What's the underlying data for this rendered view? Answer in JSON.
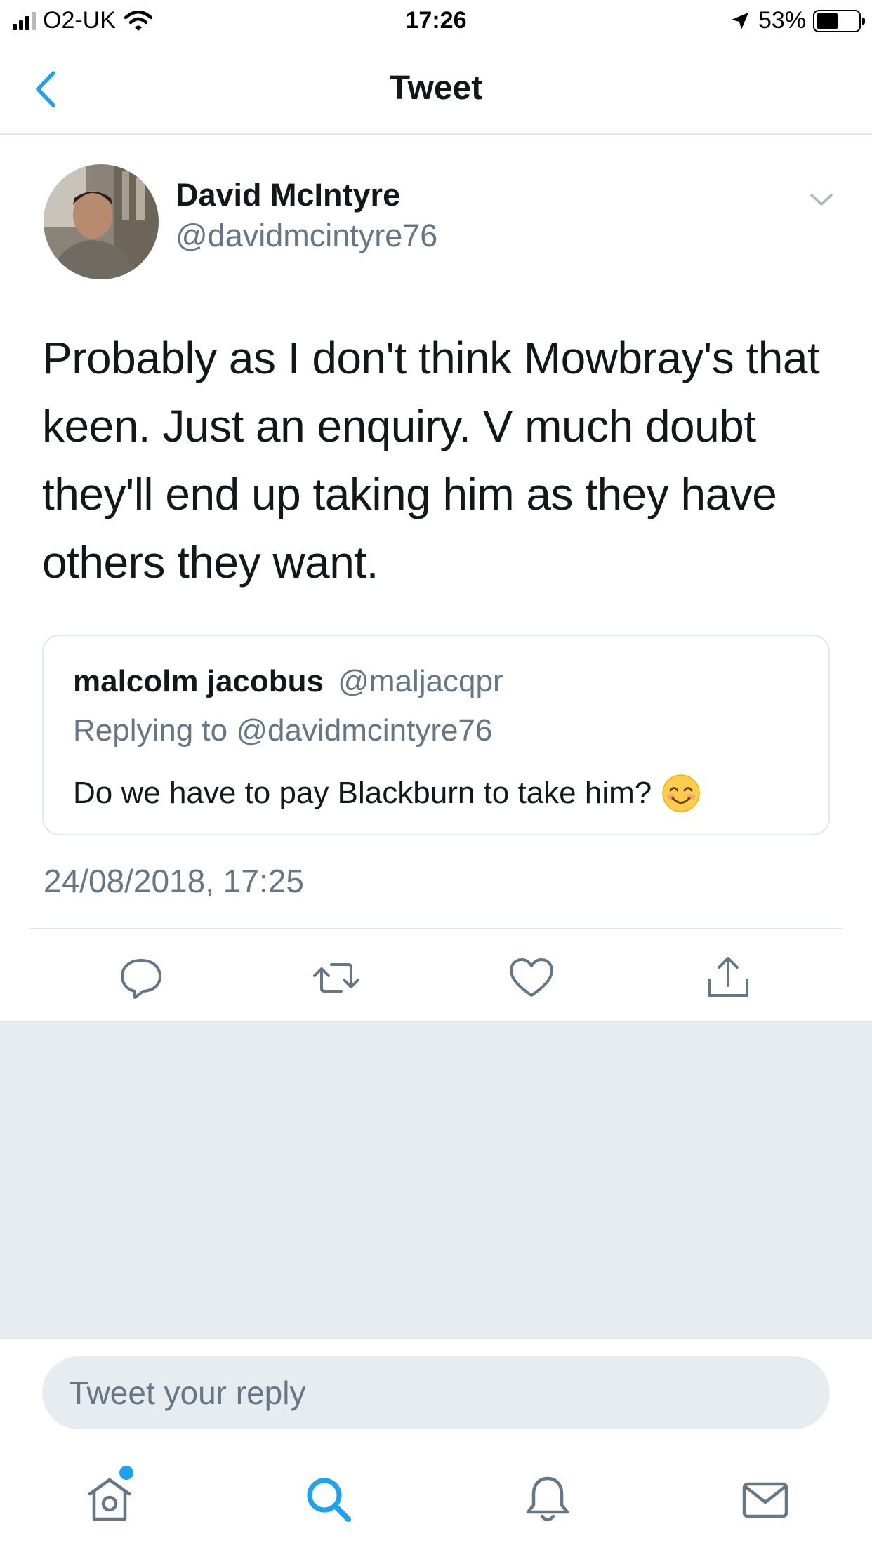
{
  "status_bar": {
    "carrier": "O2-UK",
    "time": "17:26",
    "battery": "53%"
  },
  "nav": {
    "title": "Tweet"
  },
  "tweet": {
    "author_name": "David McIntyre",
    "author_handle": "@davidmcintyre76",
    "text": "Probably as I don't think Mowbray's that keen. Just an enquiry. V much doubt they'll end up taking him as they have others they want.",
    "timestamp": "24/08/2018, 17:25"
  },
  "quoted_tweet": {
    "name": "malcolm jacobus",
    "handle": "@maljacqpr",
    "replying_to": "Replying to @davidmcintyre76",
    "text": "Do we have to pay Blackburn to take him?"
  },
  "actions": [
    "reply-icon",
    "retweet-icon",
    "like-icon",
    "share-icon"
  ],
  "reply": {
    "placeholder": "Tweet your reply"
  },
  "tab_bar": [
    "home-icon",
    "search-icon",
    "notifications-icon",
    "messages-icon"
  ],
  "colors": {
    "accent": "#1da1f2",
    "secondary_text": "#657786",
    "divider": "#e1e8ed",
    "background_gray": "#e6ecf0"
  }
}
